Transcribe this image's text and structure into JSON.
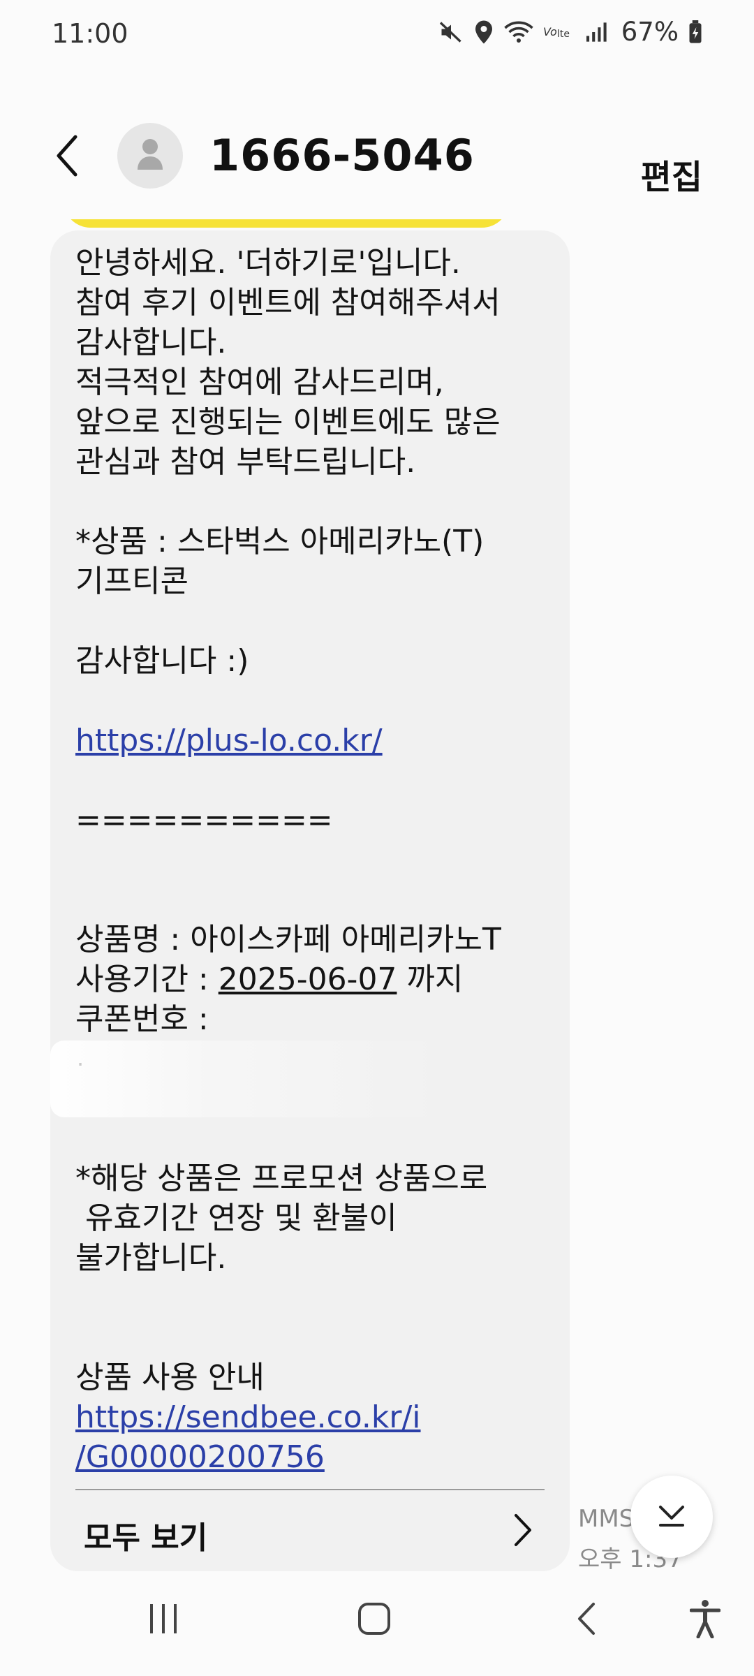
{
  "status_bar": {
    "time": "11:00",
    "battery": "67%",
    "icons": [
      "mute-icon",
      "location-icon",
      "wifi-icon",
      "volte-icon",
      "signal-icon",
      "battery-icon"
    ]
  },
  "header": {
    "contact": "1666-5046",
    "edit_label": "편집",
    "back_icon": "back-arrow-icon",
    "avatar_icon": "person-icon"
  },
  "message": {
    "lines": [
      "안녕하세요. '더하기로'입니다.",
      "참여 후기 이벤트에 참여해주셔서",
      "감사합니다.",
      "적극적인 참여에 감사드리며,",
      "앞으로 진행되는 이벤트에도 많은",
      "관심과 참여 부탁드립니다.",
      "*상품 : 스타벅스 아메리카노(T)",
      "기프티콘",
      "감사합니다 :)",
      "==========",
      "상품명 : 아이스카페 아메리카노T",
      "쿠폰번호 :",
      "*해당 상품은 프로모션 상품으로",
      " 유효기간 연장 및 환불이",
      "불가합니다.",
      "상품 사용 안내"
    ],
    "link1": "https://plus-lo.co.kr/",
    "period_label": "사용기간 : ",
    "period_date": "2025-06-07",
    "period_suffix": " 까지",
    "link2_line1": "https://sendbee.co.kr/i",
    "link2_line2": "/G00000200756",
    "view_all": "모두 보기"
  },
  "meta": {
    "type": "MMS",
    "time": "오후 1:37"
  },
  "nav": {
    "icons": [
      "recent-apps-icon",
      "home-icon",
      "back-icon",
      "accessibility-icon"
    ]
  },
  "colors": {
    "bubble": "#f1f1f1",
    "link": "#2b3fa8",
    "prev_bubble": "#f6e237"
  }
}
